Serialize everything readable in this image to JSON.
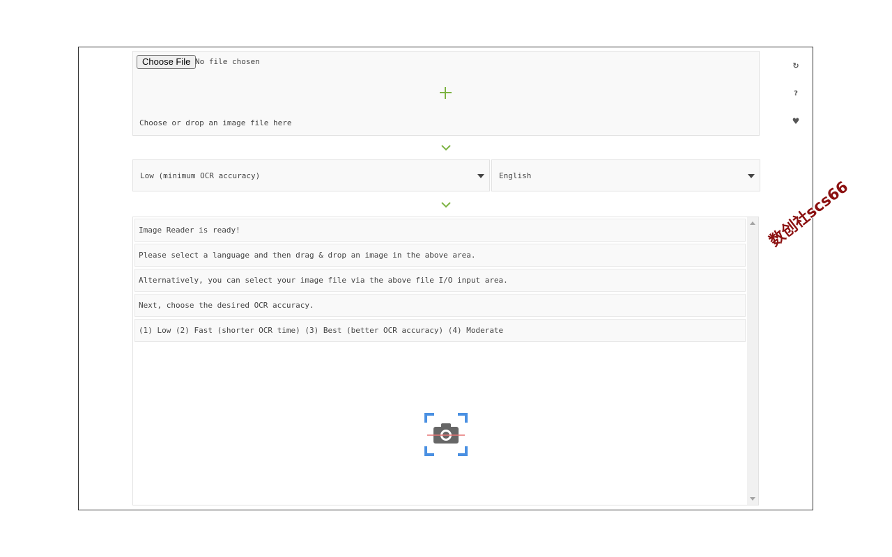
{
  "file_input": {
    "button_label": "Choose File",
    "status": "No file chosen"
  },
  "dropzone": {
    "hint": "Choose or drop an image file here",
    "add_icon": "plus-icon",
    "accent_color": "#7cb342"
  },
  "controls": {
    "accuracy_select": {
      "value": "Low (minimum OCR accuracy)"
    },
    "language_select": {
      "value": "English"
    }
  },
  "log": {
    "lines": [
      "Image Reader is ready!",
      "Please select a language and then drag & drop an image in the above area.",
      "Alternatively, you can select your image file via the above file I/O input area.",
      "Next, choose the desired OCR accuracy.",
      "(1) Low (2) Fast (shorter OCR time) (3) Best (better OCR accuracy) (4) Moderate"
    ]
  },
  "toolbar": {
    "icons": [
      "reload-icon",
      "help-icon",
      "heart-icon"
    ],
    "reload_glyph": "↻",
    "help_glyph": "?",
    "heart_glyph": "♥"
  },
  "watermark": {
    "text": "数创社scs66"
  },
  "colors": {
    "camera_frame": "#4a90e2",
    "camera_body": "#666666",
    "scan_line": "#e57373"
  }
}
